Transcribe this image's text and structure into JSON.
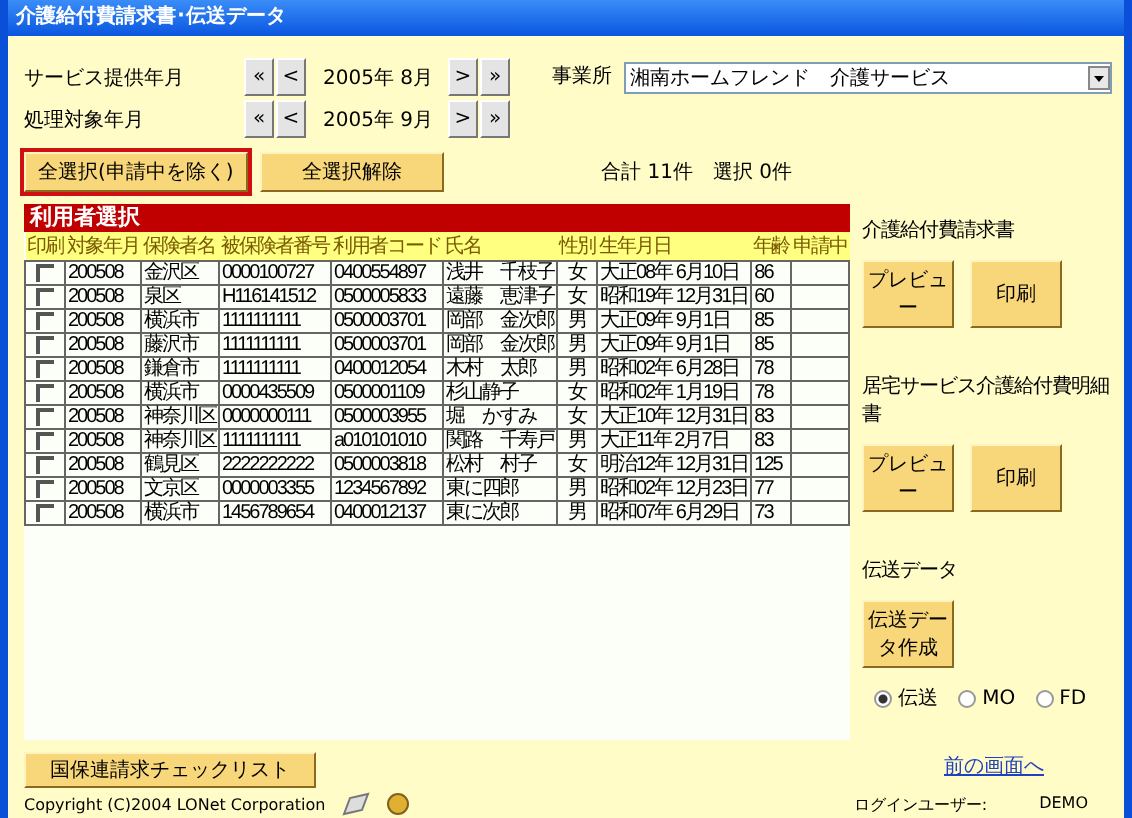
{
  "window": {
    "title": "介護給付費請求書･伝送データ"
  },
  "periods": [
    {
      "label": "サービス提供年月",
      "prev": [
        "«",
        "<"
      ],
      "value": "2005年 8月",
      "next": [
        ">",
        "»"
      ]
    },
    {
      "label": "処理対象年月",
      "prev": [
        "«",
        "<"
      ],
      "value": "2005年 9月",
      "next": [
        ">",
        "»"
      ]
    }
  ],
  "office": {
    "label": "事業所",
    "value": "湘南ホームフレンド　介護サービス"
  },
  "actions": [
    {
      "label": "全選択(申請中を除く)",
      "focused": true
    },
    {
      "label": "全選択解除",
      "focused": false
    }
  ],
  "summary": {
    "total": "合計 11件",
    "selected": "選択 0件"
  },
  "user_list": {
    "title": "利用者選択",
    "check_column": "印刷",
    "columns": [
      "対象年月",
      "保険者名",
      "被保険者番号",
      "利用者コード",
      "氏名",
      "性別",
      "生年月日",
      "年齢",
      "申請中"
    ],
    "rows": [
      {
        "checked": false,
        "cells": [
          "200508",
          "金沢区",
          "0000100727",
          "0400554897",
          "浅井　千枝子",
          "女",
          "大正08年 6月10日",
          "86"
        ]
      },
      {
        "checked": false,
        "cells": [
          "200508",
          "泉区",
          "H116141512",
          "0500005833",
          "遠藤　恵津子",
          "女",
          "昭和19年 12月31日",
          "60"
        ]
      },
      {
        "checked": false,
        "cells": [
          "200508",
          "横浜市",
          "1111111111",
          "0500003701",
          "岡部　金次郎",
          "男",
          "大正09年 9月1日",
          "85"
        ]
      },
      {
        "checked": false,
        "cells": [
          "200508",
          "藤沢市",
          "1111111111",
          "0500003701",
          "岡部　金次郎",
          "男",
          "大正09年 9月1日",
          "85"
        ]
      },
      {
        "checked": false,
        "cells": [
          "200508",
          "鎌倉市",
          "1111111111",
          "0400012054",
          "木村　太郎",
          "男",
          "昭和02年 6月28日",
          "78"
        ]
      },
      {
        "checked": false,
        "cells": [
          "200508",
          "横浜市",
          "0000435509",
          "0500001109",
          "杉山静子",
          "女",
          "昭和02年 1月19日",
          "78"
        ]
      },
      {
        "checked": false,
        "cells": [
          "200508",
          "神奈川区",
          "0000000111",
          "0500003955",
          "堀　かすみ",
          "女",
          "大正10年 12月31日",
          "83"
        ]
      },
      {
        "checked": false,
        "cells": [
          "200508",
          "神奈川区",
          "1111111111",
          "a010101010",
          "関路　千寿戸",
          "男",
          "大正11年 2月7日",
          "83"
        ]
      },
      {
        "checked": false,
        "cells": [
          "200508",
          "鶴見区",
          "2222222222",
          "0500003818",
          "松村　村子",
          "女",
          "明治12年 12月31日",
          "125"
        ]
      },
      {
        "checked": false,
        "cells": [
          "200508",
          "文京区",
          "0000003355",
          "1234567892",
          "東に四郎",
          "男",
          "昭和02年 12月23日",
          "77"
        ]
      },
      {
        "checked": false,
        "cells": [
          "200508",
          "横浜市",
          "1456789654",
          "0400012137",
          "東に次郎",
          "男",
          "昭和07年 6月29日",
          "73"
        ]
      }
    ]
  },
  "checklist_button": "国保連請求チェックリスト",
  "sections": [
    {
      "kind": "buttons",
      "title": "介護給付費請求書",
      "buttons": [
        "プレビュー",
        "印刷"
      ]
    },
    {
      "kind": "buttons",
      "title": "居宅サービス介護給付費明細書",
      "buttons": [
        "プレビュー",
        "印刷"
      ]
    },
    {
      "kind": "transfer",
      "title": "伝送データ",
      "buttons": [
        "伝送データ作成"
      ],
      "options": [
        {
          "label": "伝送",
          "selected": true
        },
        {
          "label": "MO",
          "selected": false
        },
        {
          "label": "FD",
          "selected": false
        }
      ]
    }
  ],
  "back_link": "前の画面へ",
  "footer": {
    "copyright": "Copyright (C)2004 LONet Corporation",
    "login_label": "ログインユーザー:",
    "login_user": "DEMO"
  }
}
